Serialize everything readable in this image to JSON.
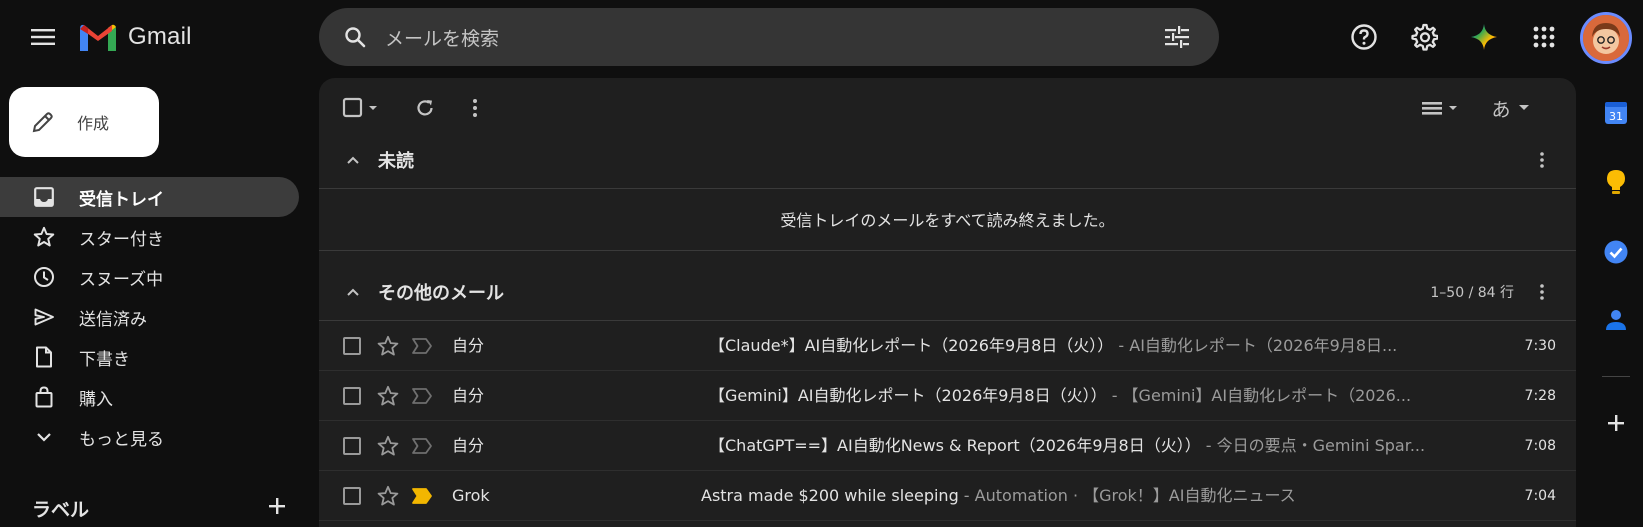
{
  "app": {
    "name": "Gmail"
  },
  "search": {
    "placeholder": "メールを検索"
  },
  "compose": {
    "label": "作成"
  },
  "nav": [
    {
      "label": "受信トレイ",
      "icon": "inbox-icon",
      "active": true
    },
    {
      "label": "スター付き",
      "icon": "star-icon"
    },
    {
      "label": "スヌーズ中",
      "icon": "clock-icon"
    },
    {
      "label": "送信済み",
      "icon": "send-icon"
    },
    {
      "label": "下書き",
      "icon": "draft-icon"
    },
    {
      "label": "購入",
      "icon": "shopping-bag-icon"
    },
    {
      "label": "もっと見る",
      "icon": "chevron-down-icon"
    }
  ],
  "labels": {
    "title": "ラベル"
  },
  "toolbar": {
    "display_density_label": "あ"
  },
  "sections": {
    "unread": {
      "title": "未読",
      "empty_message": "受信トレイのメールをすべて読み終えました。"
    },
    "other": {
      "title": "その他のメール",
      "count": "1–50 / 84 行"
    }
  },
  "emails": [
    {
      "sender": "自分",
      "subject": "【Claude*】AI自動化レポート（2026年9月8日（火））",
      "snippet": " - AI自動化レポート（2026年9月8日...",
      "time": "7:30",
      "important": false
    },
    {
      "sender": "自分",
      "subject": "【Gemini】AI自動化レポート（2026年9月8日（火））",
      "snippet": " - 【Gemini】AI自動化レポート（2026...",
      "time": "7:28",
      "important": false
    },
    {
      "sender": "自分",
      "subject": "【ChatGPT==】AI自動化News & Report（2026年9月8日（火））",
      "snippet": " - 今日の要点・Gemini Spar...",
      "time": "7:08",
      "important": false
    },
    {
      "sender": "Grok",
      "subject": "Astra made $200 while sleeping",
      "snippet": " - Automation · 【Grok！】AI自動化ニュース",
      "time": "7:04",
      "important": true
    }
  ],
  "colors": {
    "background": "#0f0f0f",
    "panel": "#1f1f1f",
    "search": "#353535",
    "active_nav": "#3c3c3c",
    "important_marker": "#f2b600",
    "avatar_ring": "#6b8cff"
  }
}
